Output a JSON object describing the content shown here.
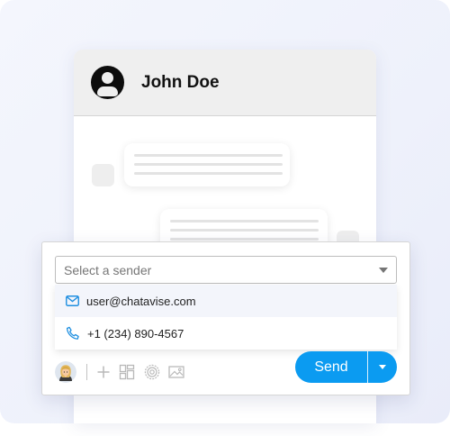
{
  "contact": {
    "name": "John Doe",
    "avatar_icon": "user-circle-icon"
  },
  "composer": {
    "sender_select": {
      "placeholder": "Select a sender",
      "caret_icon": "chevron-down-icon"
    },
    "sender_options": [
      {
        "icon": "mail-icon",
        "label": "user@chatavise.com",
        "highlighted": true
      },
      {
        "icon": "phone-icon",
        "label": "+1 (234) 890-4567",
        "highlighted": false
      }
    ],
    "toolbar": {
      "agent_avatar_icon": "agent-avatar-icon",
      "icons": [
        "plus-icon",
        "templates-icon",
        "target-icon",
        "image-icon"
      ]
    },
    "send": {
      "label": "Send",
      "dropdown_icon": "chevron-down-icon"
    }
  },
  "colors": {
    "accent": "#0b9bf1",
    "header_bg": "#efefef",
    "option_highlight": "#f3f5fb",
    "icon_blue": "#1f8fe0"
  }
}
